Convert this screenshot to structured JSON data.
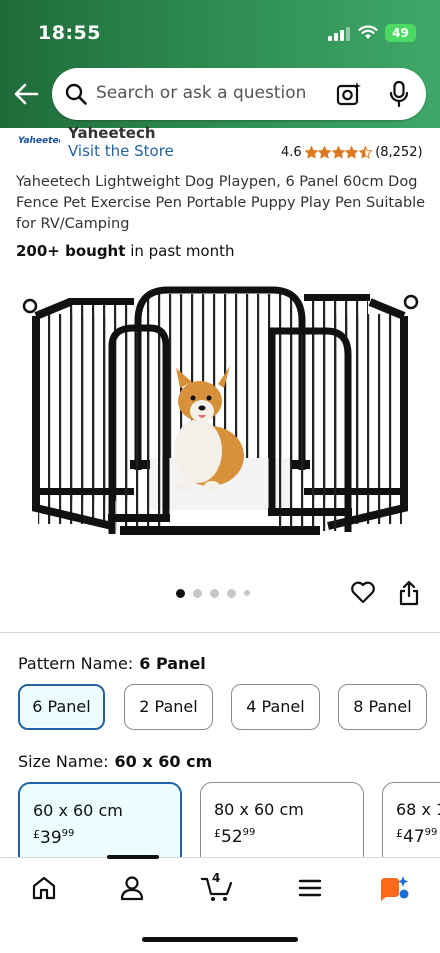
{
  "status_bar": {
    "time": "18:55",
    "battery": "49"
  },
  "search": {
    "placeholder": "Search or ask a question"
  },
  "brand": {
    "logo_text": "Yaheetech",
    "name": "Yaheetech",
    "visit_store": "Visit the Store"
  },
  "rating": {
    "value": "4.6",
    "stars": 4.5,
    "count": "(8,252)"
  },
  "product": {
    "title": "Yaheetech Lightweight Dog Playpen, 6 Panel 60cm Dog Fence Pet Exercise Pen Portable Puppy Play Pen Suitable for RV/Camping",
    "bought_count": "200+ bought",
    "bought_suffix": "in past month",
    "image_count": 5,
    "image_index": 0
  },
  "pattern": {
    "label": "Pattern Name:",
    "selected": "6 Panel",
    "options": [
      "6 Panel",
      "2 Panel",
      "4 Panel",
      "8 Panel"
    ]
  },
  "size": {
    "label": "Size Name:",
    "selected": "60 x 60 cm",
    "options": [
      {
        "name": "60 x 60 cm",
        "currency": "£",
        "whole": "39",
        "fraction": "99"
      },
      {
        "name": "80 x 60 cm",
        "currency": "£",
        "whole": "52",
        "fraction": "99"
      },
      {
        "name": "68 x 1",
        "currency": "£",
        "whole": "47",
        "fraction": "99"
      }
    ]
  },
  "bottom_nav": {
    "items": [
      "home-icon",
      "account-icon",
      "cart-icon",
      "menu-icon",
      "rufus-icon"
    ],
    "cart_count": "4"
  },
  "colors": {
    "accent": "#2162a1",
    "header_green": "#2d8a4e",
    "star": "#de7921"
  }
}
